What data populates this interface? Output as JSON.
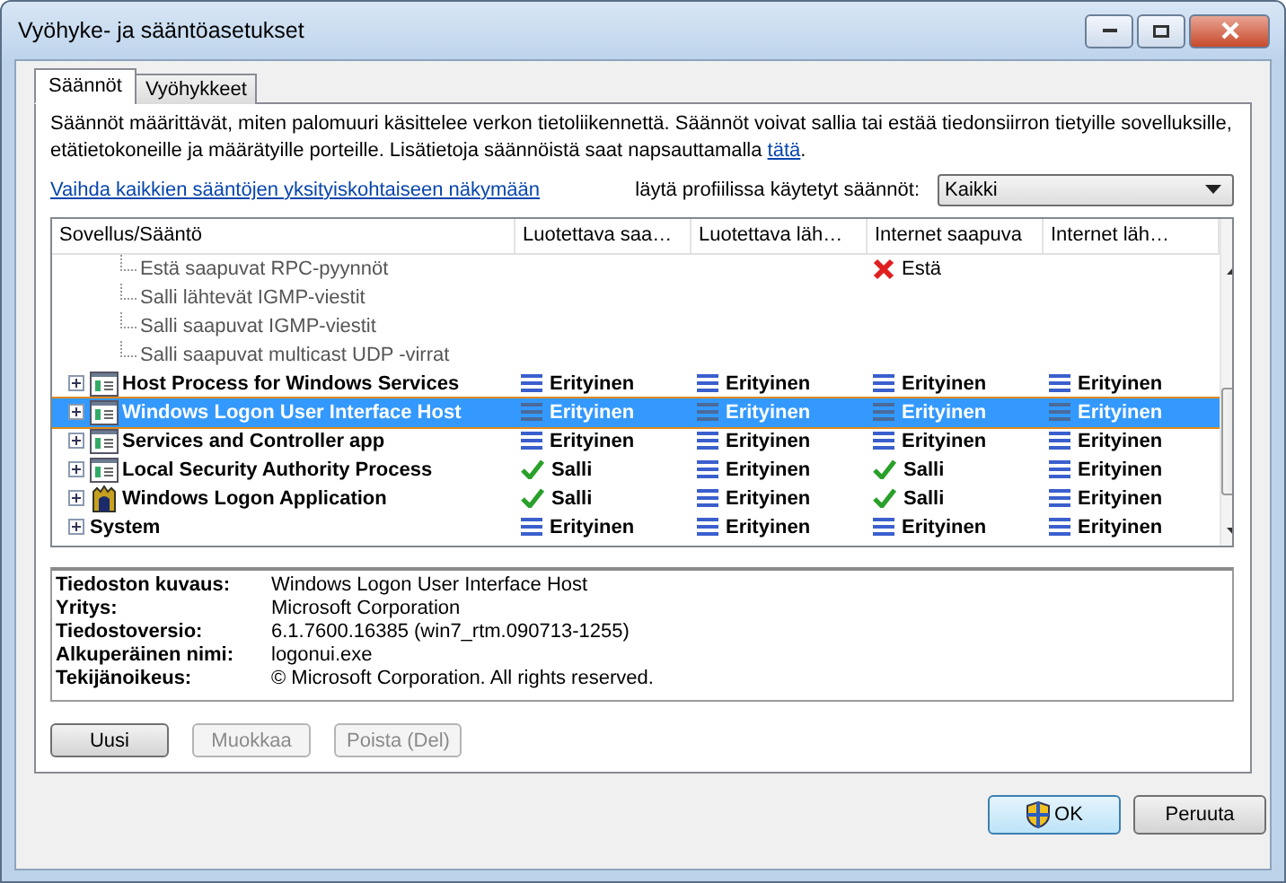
{
  "window": {
    "title": "Vyöhyke- ja sääntöasetukset"
  },
  "tabs": [
    {
      "label": "Säännöt",
      "selected": true
    },
    {
      "label": "Vyöhykkeet",
      "selected": false
    }
  ],
  "intro": {
    "text": "Säännöt määrittävät, miten palomuuri käsittelee verkon tietoliikennettä. Säännöt voivat sallia tai estää tiedonsiirron tietyille sovelluksille, etätietokoneille ja määrätyille porteille. Lisätietoja säännöistä saat napsauttamalla",
    "link": "tätä",
    "end": "."
  },
  "detail_link": "Vaihda kaikkien sääntöjen yksityiskohtaiseen näkymään",
  "profile_filter": {
    "label": "läytä profiilissa käytetyt säännöt:",
    "value": "Kaikki"
  },
  "table": {
    "columns": [
      "Sovellus/Sääntö",
      "Luotettava saa…",
      "Luotettava läh…",
      "Internet saapuva",
      "Internet läh…"
    ],
    "rows": [
      {
        "kind": "rule",
        "selected": false,
        "cells": [
          "Estä saapuvat RPC-pyynnöt",
          "",
          "",
          {
            "kind": "block",
            "text": "Estä"
          },
          ""
        ]
      },
      {
        "kind": "rule",
        "selected": false,
        "cells": [
          "Salli lähtevät IGMP-viestit",
          "",
          "",
          "",
          ""
        ]
      },
      {
        "kind": "rule",
        "selected": false,
        "cells": [
          "Salli saapuvat IGMP-viestit",
          "",
          "",
          "",
          ""
        ]
      },
      {
        "kind": "rule",
        "selected": false,
        "cells": [
          "Salli saapuvat multicast UDP -virrat",
          "",
          "",
          "",
          ""
        ]
      },
      {
        "kind": "app-window",
        "selected": false,
        "cells": [
          "Host Process for Windows Services",
          {
            "kind": "custom",
            "text": "Erityinen"
          },
          {
            "kind": "custom",
            "text": "Erityinen"
          },
          {
            "kind": "custom",
            "text": "Erityinen"
          },
          {
            "kind": "custom",
            "text": "Erityinen"
          }
        ]
      },
      {
        "kind": "app-window",
        "selected": true,
        "cells": [
          "Windows Logon User Interface Host",
          {
            "kind": "custom",
            "text": "Erityinen"
          },
          {
            "kind": "custom",
            "text": "Erityinen"
          },
          {
            "kind": "custom",
            "text": "Erityinen"
          },
          {
            "kind": "custom",
            "text": "Erityinen"
          }
        ]
      },
      {
        "kind": "app-window",
        "selected": false,
        "cells": [
          "Services and Controller app",
          {
            "kind": "custom",
            "text": "Erityinen"
          },
          {
            "kind": "custom",
            "text": "Erityinen"
          },
          {
            "kind": "custom",
            "text": "Erityinen"
          },
          {
            "kind": "custom",
            "text": "Erityinen"
          }
        ]
      },
      {
        "kind": "app-window",
        "selected": false,
        "cells": [
          "Local Security Authority Process",
          {
            "kind": "allow",
            "text": "Salli"
          },
          {
            "kind": "custom",
            "text": "Erityinen"
          },
          {
            "kind": "allow",
            "text": "Salli"
          },
          {
            "kind": "custom",
            "text": "Erityinen"
          }
        ]
      },
      {
        "kind": "app-logon",
        "selected": false,
        "cells": [
          "Windows Logon Application",
          {
            "kind": "allow",
            "text": "Salli"
          },
          {
            "kind": "custom",
            "text": "Erityinen"
          },
          {
            "kind": "allow",
            "text": "Salli"
          },
          {
            "kind": "custom",
            "text": "Erityinen"
          }
        ]
      },
      {
        "kind": "app-plain",
        "selected": false,
        "cells": [
          "System",
          {
            "kind": "custom",
            "text": "Erityinen"
          },
          {
            "kind": "custom",
            "text": "Erityinen"
          },
          {
            "kind": "custom",
            "text": "Erityinen"
          },
          {
            "kind": "custom",
            "text": "Erityinen"
          }
        ]
      }
    ]
  },
  "details": [
    {
      "label": "Tiedoston kuvaus:",
      "value": "Windows Logon User Interface Host"
    },
    {
      "label": "Yritys:",
      "value": "Microsoft Corporation"
    },
    {
      "label": "Tiedostoversio:",
      "value": "6.1.7600.16385 (win7_rtm.090713-1255)"
    },
    {
      "label": "Alkuperäinen nimi:",
      "value": "logonui.exe"
    },
    {
      "label": "Tekijänoikeus:",
      "value": "© Microsoft Corporation. All rights reserved."
    }
  ],
  "actions": [
    {
      "label": "Uusi",
      "disabled": false
    },
    {
      "label": "Muokkaa",
      "disabled": true
    },
    {
      "label": "Poista (Del)",
      "disabled": true
    }
  ],
  "buttons": [
    {
      "label": "OK",
      "kind": "ok"
    },
    {
      "label": "Peruuta",
      "kind": "cancel"
    }
  ]
}
